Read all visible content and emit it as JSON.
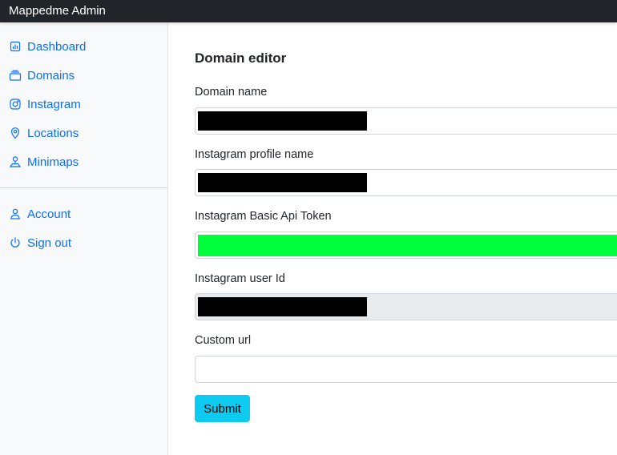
{
  "app": {
    "brand": "Mappedme Admin"
  },
  "sidebar": {
    "items": [
      {
        "label": "Dashboard",
        "icon": "dashboard-icon"
      },
      {
        "label": "Domains",
        "icon": "domains-icon"
      },
      {
        "label": "Instagram",
        "icon": "instagram-icon"
      },
      {
        "label": "Locations",
        "icon": "location-pin-icon"
      },
      {
        "label": "Minimaps",
        "icon": "minimap-icon"
      }
    ],
    "account_items": [
      {
        "label": "Account",
        "icon": "user-icon"
      },
      {
        "label": "Sign out",
        "icon": "power-icon"
      }
    ],
    "link_color": "#0d6efd"
  },
  "form": {
    "title": "Domain editor",
    "fields": [
      {
        "label": "Domain name",
        "value": "",
        "redacted": "black"
      },
      {
        "label": "Instagram profile name",
        "value": "",
        "redacted": "black"
      },
      {
        "label": "Instagram Basic Api Token",
        "value": "",
        "redacted": "green"
      },
      {
        "label": "Instagram user Id",
        "value": "",
        "redacted": "black",
        "readonly": true
      },
      {
        "label": "Custom url",
        "value": ""
      }
    ],
    "submit_label": "Submit",
    "submit_color": "#0dcaf0"
  }
}
